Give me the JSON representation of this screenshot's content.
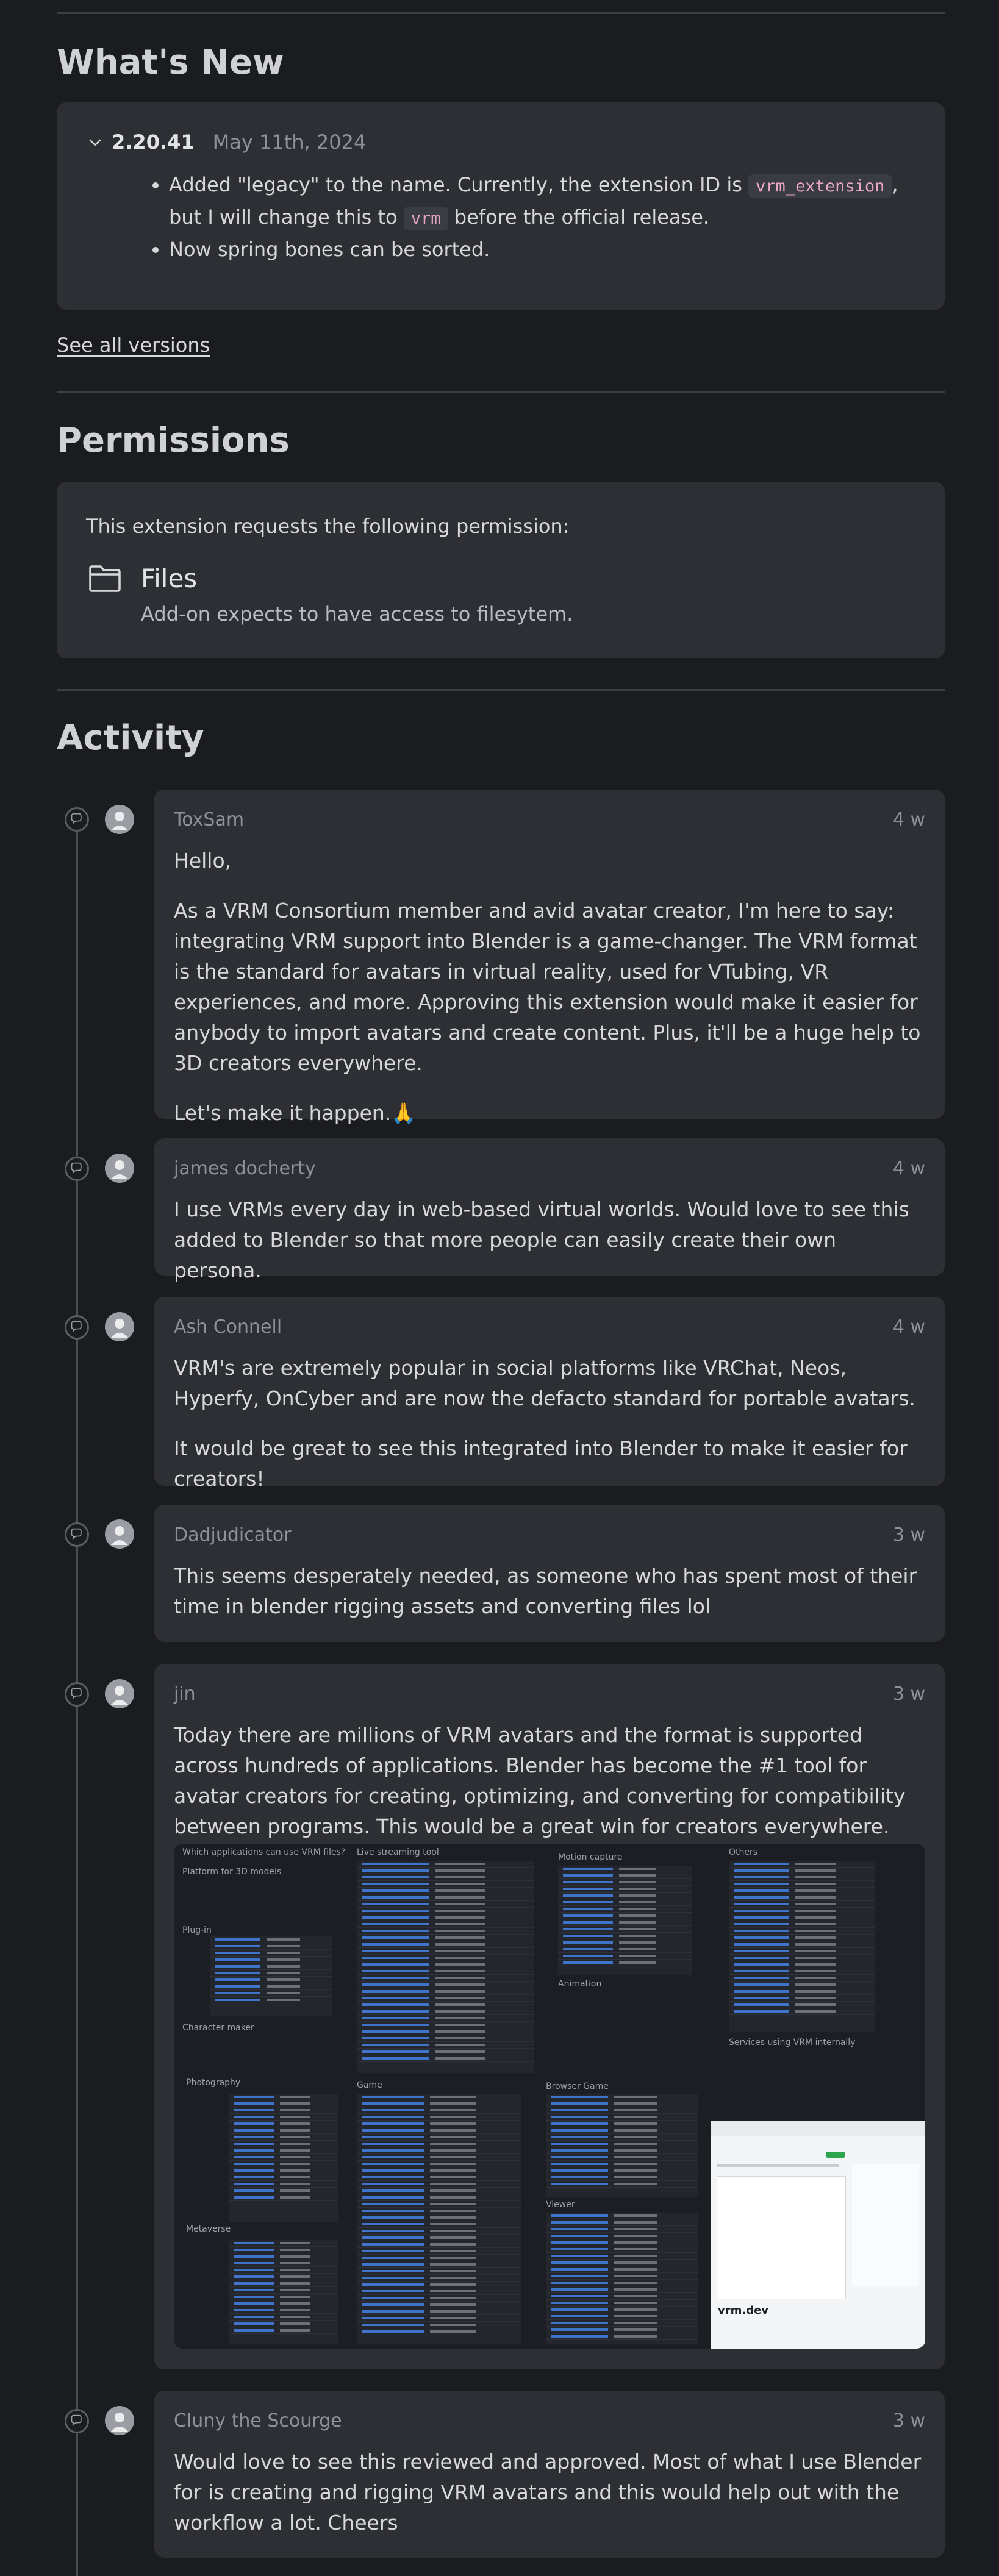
{
  "whats_new": {
    "heading": "What's New",
    "version": "2.20.41",
    "date": "May 11th, 2024",
    "notes": [
      {
        "before": "Added \"legacy\" to the name. Currently, the extension ID is",
        "code1": "vrm_extension",
        "middle": ", but I will change this to",
        "code2": "vrm",
        "after": "before the official release."
      },
      {
        "text": "Now spring bones can be sorted."
      }
    ],
    "see_all": "See all versions"
  },
  "permissions": {
    "heading": "Permissions",
    "intro": "This extension requests the following permission:",
    "items": [
      {
        "icon": "folder-icon",
        "title": "Files",
        "description": "Add-on expects to have access to filesytem."
      }
    ]
  },
  "activity": {
    "heading": "Activity",
    "comments": [
      {
        "author": "ToxSam",
        "age": "4 w",
        "paragraphs": [
          "Hello,",
          "As a VRM Consortium member and avid avatar creator, I'm here to say: integrating VRM support into Blender is a game-changer. The VRM format is the standard for avatars in virtual reality, used for VTubing, VR experiences, and more. Approving this extension would make it easier for anybody to import avatars and create content. Plus, it'll be a huge help to 3D creators everywhere.",
          "Let's make it happen.🙏"
        ]
      },
      {
        "author": "james docherty",
        "age": "4 w",
        "paragraphs": [
          "I use VRMs every day in web-based virtual worlds. Would love to see this added to Blender so that more people can easily create their own persona."
        ]
      },
      {
        "author": "Ash Connell",
        "age": "4 w",
        "paragraphs": [
          "VRM's are extremely popular in social platforms like VRChat, Neos, Hyperfy, OnCyber and are now the defacto standard for portable avatars.",
          "It would be great to see this integrated into Blender to make it easier for creators!"
        ]
      },
      {
        "author": "Dadjudicator",
        "age": "3 w",
        "paragraphs": [
          "This seems desperately needed, as someone who has spent most of their time in blender rigging assets and converting files lol"
        ]
      },
      {
        "author": "jin",
        "age": "3 w",
        "paragraphs": [
          "Today there are millions of VRM avatars and the format is supported across hundreds of applications. Blender has become the #1 tool for avatar creators for creating, optimizing, and converting for compatibility between programs. This would be a great win for creators everywhere."
        ],
        "image_titles": [
          "Which applications can use VRM files?",
          "Live streaming tool",
          "Motion capture",
          "Others",
          "Platform for 3D models",
          "Plug-in",
          "Animation",
          "Character maker",
          "Services using VRM internally",
          "Photography",
          "Game",
          "Browser Game",
          "Metaverse",
          "Viewer",
          "vrm.dev"
        ]
      },
      {
        "author": "Cluny the Scourge",
        "age": "3 w",
        "paragraphs": [
          "Would love to see this reviewed and approved. Most of what I use Blender for is creating and rigging VRM avatars and this would help out with the workflow a lot. Cheers"
        ]
      }
    ]
  }
}
